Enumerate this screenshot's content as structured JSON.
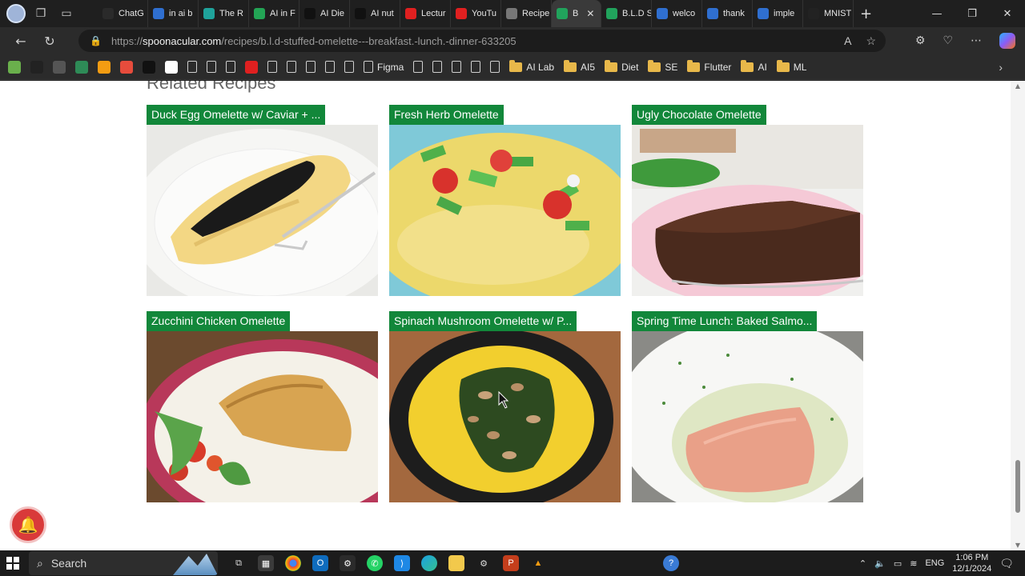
{
  "browser": {
    "tabs": [
      {
        "label": "ChatG",
        "color": "#2a2a2a",
        "active": false
      },
      {
        "label": "in ai b",
        "color": "#2f6fd0",
        "active": false
      },
      {
        "label": "The R",
        "color": "#1fa39b",
        "active": false
      },
      {
        "label": "AI in F",
        "color": "#23a455",
        "active": false
      },
      {
        "label": "AI Die",
        "color": "#111111",
        "active": false
      },
      {
        "label": "AI nut",
        "color": "#111111",
        "active": false
      },
      {
        "label": "Lectur",
        "color": "#e02020",
        "active": false
      },
      {
        "label": "YouTu",
        "color": "#e02020",
        "active": false
      },
      {
        "label": "Recipe",
        "color": "#777777",
        "active": false
      },
      {
        "label": "B",
        "color": "#21a35c",
        "active": true
      },
      {
        "label": "B.L.D S",
        "color": "#21a35c",
        "active": false
      },
      {
        "label": "welco",
        "color": "#2f6fd0",
        "active": false
      },
      {
        "label": "thank",
        "color": "#2f6fd0",
        "active": false
      },
      {
        "label": "imple",
        "color": "#2f6fd0",
        "active": false
      },
      {
        "label": "MNIST",
        "color": "#222222",
        "active": false
      }
    ],
    "url_prefix": "https://",
    "url_domain": "spoonacular.com",
    "url_path": "/recipes/b.l.d-stuffed-omelette---breakfast.-lunch.-dinner-633205",
    "bookmarks": [
      {
        "type": "icon",
        "color": "#6ab04c",
        "label": ""
      },
      {
        "type": "icon",
        "color": "#222222",
        "label": ""
      },
      {
        "type": "icon",
        "color": "#555555",
        "label": ""
      },
      {
        "type": "icon",
        "color": "#2e8b57",
        "label": ""
      },
      {
        "type": "icon",
        "color": "#f39c12",
        "label": ""
      },
      {
        "type": "icon",
        "color": "#e74c3c",
        "label": ""
      },
      {
        "type": "icon",
        "color": "#111111",
        "label": ""
      },
      {
        "type": "icon",
        "color": "#ffffff",
        "label": ""
      },
      {
        "type": "page",
        "label": ""
      },
      {
        "type": "page",
        "label": ""
      },
      {
        "type": "page",
        "label": ""
      },
      {
        "type": "icon",
        "color": "#e02020",
        "label": ""
      },
      {
        "type": "page",
        "label": ""
      },
      {
        "type": "page",
        "label": ""
      },
      {
        "type": "page",
        "label": ""
      },
      {
        "type": "page",
        "label": ""
      },
      {
        "type": "page",
        "label": ""
      },
      {
        "type": "page",
        "label": "Figma"
      },
      {
        "type": "page",
        "label": ""
      },
      {
        "type": "page",
        "label": ""
      },
      {
        "type": "page",
        "label": ""
      },
      {
        "type": "page",
        "label": ""
      },
      {
        "type": "page",
        "label": ""
      },
      {
        "type": "folder",
        "label": "AI Lab"
      },
      {
        "type": "folder",
        "label": "AI5"
      },
      {
        "type": "folder",
        "label": "Diet"
      },
      {
        "type": "folder",
        "label": "SE"
      },
      {
        "type": "folder",
        "label": "Flutter"
      },
      {
        "type": "folder",
        "label": "AI"
      },
      {
        "type": "folder",
        "label": "ML"
      }
    ]
  },
  "page": {
    "section_title": "Related Recipes",
    "cards": [
      {
        "title": "Duck Egg Omelette w/ Caviar + ...",
        "image": "duck-egg-omelette"
      },
      {
        "title": "Fresh Herb Omelette",
        "image": "fresh-herb-omelette"
      },
      {
        "title": "Ugly Chocolate Omelette",
        "image": "ugly-chocolate-omelette"
      },
      {
        "title": "Zucchini Chicken Omelette",
        "image": "zucchini-chicken-omelette"
      },
      {
        "title": "Spinach Mushroom Omelette w/ P...",
        "image": "spinach-mushroom-omelette"
      },
      {
        "title": "Spring Time Lunch: Baked Salmo...",
        "image": "baked-salmon"
      }
    ],
    "accent_color": "#12873a"
  },
  "taskbar": {
    "search_placeholder": "Search",
    "language": "ENG",
    "time": "1:06 PM",
    "date": "12/1/2024"
  }
}
